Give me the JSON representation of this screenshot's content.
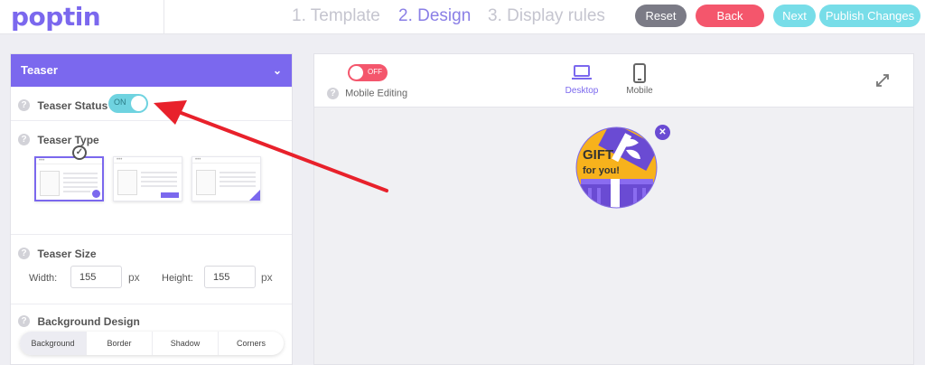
{
  "header": {
    "logo": "poptin",
    "steps": [
      {
        "label": "1. Template",
        "active": false
      },
      {
        "label": "2. Design",
        "active": true
      },
      {
        "label": "3. Display rules",
        "active": false
      }
    ],
    "buttons": {
      "reset": "Reset",
      "back": "Back",
      "next": "Next",
      "publish": "Publish Changes"
    }
  },
  "panel": {
    "title": "Teaser",
    "status": {
      "label": "Teaser Status",
      "toggle": "ON"
    },
    "type": {
      "label": "Teaser Type"
    },
    "size": {
      "label": "Teaser Size",
      "width_label": "Width:",
      "width_value": "155",
      "height_label": "Height:",
      "height_value": "155",
      "unit": "px"
    },
    "background": {
      "label": "Background Design",
      "tabs": [
        "Background",
        "Border",
        "Shadow",
        "Corners"
      ]
    },
    "help": "?"
  },
  "preview": {
    "mobile_toggle": "OFF",
    "mobile_editing": "Mobile Editing",
    "devices": [
      {
        "label": "Desktop",
        "active": true
      },
      {
        "label": "Mobile",
        "active": false
      }
    ],
    "teaser": {
      "line1": "GIFT",
      "line2": "for you!"
    }
  },
  "colors": {
    "brand": "#7b68ee",
    "danger": "#f4566c",
    "cyan": "#77dde8",
    "arrow": "#e8212b"
  }
}
